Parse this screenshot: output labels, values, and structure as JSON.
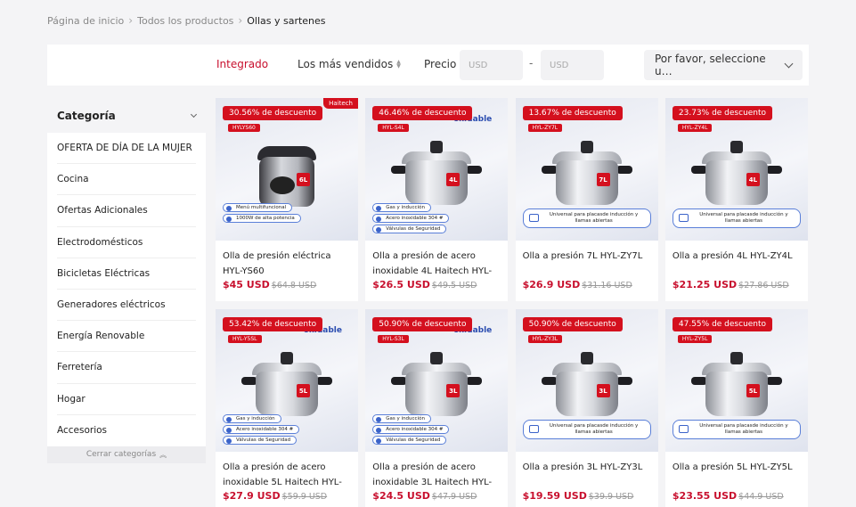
{
  "breadcrumb": [
    "Página de inicio",
    "Todos los productos",
    "Ollas y sartenes"
  ],
  "filters": {
    "integrado": "Integrado",
    "best_sellers": "Los más vendidos",
    "price_label": "Precio",
    "price_min_placeholder": "USD",
    "price_max_placeholder": "USD",
    "dash": "-",
    "select_placeholder": "Por favor, seleccione u…"
  },
  "sidebar": {
    "title": "Categoría",
    "items": [
      "OFERTA DE DÍA DE LA MUJER",
      "Cocina",
      "Ofertas Adicionales",
      "Electrodomésticos",
      "Bicicletas Eléctricas",
      "Generadores eléctricos",
      "Energía Renovable",
      "Ferretería",
      "Hogar",
      "Accesorios"
    ],
    "collapse_label": "Cerrar categorías"
  },
  "products": [
    {
      "discount": "30.56% de descuento",
      "model": "HYLYS60",
      "brand": "Haitech",
      "size": "6L",
      "type": "electric",
      "badges": [
        "Menú multifuncional",
        "1000W de alta potencia"
      ],
      "title": "Olla de presión eléctrica HYL-YS60",
      "price": "$45 USD",
      "old_price": "$64.8 USD"
    },
    {
      "discount": "46.46% de descuento",
      "model": "HYL-S4L",
      "overlay": "oxidable",
      "size": "4L",
      "type": "badges",
      "badges": [
        "Gas y inducción",
        "Acero inoxidable 304 #",
        "Válvulas de Seguridad"
      ],
      "title": "Olla a presión de acero inoxidable 4L Haitech HYL-S4L",
      "price": "$26.5 USD",
      "old_price": "$49.5 USD"
    },
    {
      "discount": "13.67% de descuento",
      "model": "HYL-ZY7L",
      "size": "7L",
      "type": "info",
      "info": "Universal para placasde inducción y llamas abiertas",
      "title": "Olla a presión 7L HYL-ZY7L",
      "price": "$26.9 USD",
      "old_price": "$31.16 USD"
    },
    {
      "discount": "23.73% de descuento",
      "model": "HYL-ZY4L",
      "size": "4L",
      "type": "info",
      "info": "Universal para placasde inducción y llamas abiertas",
      "title": "Olla a presión 4L HYL-ZY4L",
      "price": "$21.25 USD",
      "old_price": "$27.86 USD"
    },
    {
      "discount": "53.42% de descuento",
      "model": "HYL-Y5SL",
      "overlay": "oxidable",
      "size": "5L",
      "type": "badges",
      "badges": [
        "Gas y inducción",
        "Acero inoxidable 304 #",
        "Válvulas de Seguridad"
      ],
      "title": "Olla a presión de acero inoxidable 5L Haitech HYL-S5L",
      "price": "$27.9 USD",
      "old_price": "$59.9 USD"
    },
    {
      "discount": "50.90% de descuento",
      "model": "HYL-S3L",
      "overlay": "oxidable",
      "size": "3L",
      "type": "badges",
      "badges": [
        "Gas y inducción",
        "Acero inoxidable 304 #",
        "Válvulas de Seguridad"
      ],
      "title": "Olla a presión de acero inoxidable 3L Haitech HYL-S3L",
      "price": "$24.5 USD",
      "old_price": "$47.9 USD"
    },
    {
      "discount": "50.90% de descuento",
      "model": "HYL-ZY3L",
      "size": "3L",
      "type": "info",
      "info": "Universal para placasde inducción y llamas abiertas",
      "title": "Olla a presión 3L HYL-ZY3L",
      "price": "$19.59 USD",
      "old_price": "$39.9 USD"
    },
    {
      "discount": "47.55% de descuento",
      "model": "HYL-ZY5L",
      "size": "5L",
      "type": "info",
      "info": "Universal para placasde inducción y llamas abiertas",
      "title": "Olla a presión 5L HYL-ZY5L",
      "price": "$23.55 USD",
      "old_price": "$44.9 USD"
    }
  ]
}
